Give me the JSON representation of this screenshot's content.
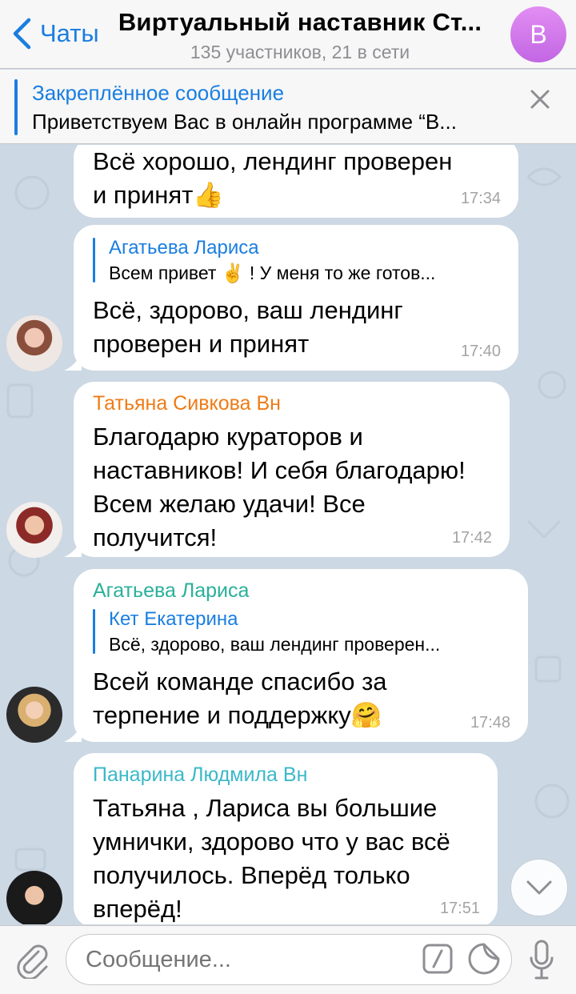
{
  "header": {
    "back_label": "Чаты",
    "title": "Виртуальный наставник Ст...",
    "subtitle": "135 участников, 21 в сети",
    "avatar_letter": "В",
    "avatar_color": "#d580ee"
  },
  "pinned": {
    "title": "Закреплённое сообщение",
    "text": "Приветствуем Вас в онлайн программе “В..."
  },
  "messages": [
    {
      "text": "Всё хорошо, лендинг проверен\nи принят",
      "emoji": "👍",
      "time": "17:34"
    },
    {
      "reply_name": "Агатьева Лариса",
      "reply_text": "Всем привет ✌️ ! У меня то же готов...",
      "text": "Всё, здорово, ваш лендинг\nпроверен и принят",
      "time": "17:40"
    },
    {
      "sender": "Татьяна Сивкова Вн",
      "sender_color": "#ef7b16",
      "text": "Благодарю кураторов и\nнаставников! И себя благодарю!\nВсем желаю удачи! Все\nполучится!",
      "time": "17:42"
    },
    {
      "sender": "Агатьева Лариса",
      "sender_color": "#2ab09a",
      "reply_name": "Кет Екатерина",
      "reply_text": "Всё, здорово, ваш лендинг проверен...",
      "text": "Всей команде спасибо за\nтерпение и поддержку",
      "emoji": "🤗",
      "time": "17:48"
    },
    {
      "sender": "Панарина Людмила Вн",
      "sender_color": "#3bb8c9",
      "text": "Татьяна , Лариса вы большие\nумнички, здорово что у вас всё\nполучилось. Вперёд только\nвперёд!",
      "time": "17:51"
    }
  ],
  "composer": {
    "placeholder": "Сообщение..."
  },
  "icons": {
    "back": "chevron-left-icon",
    "close": "close-icon",
    "attach": "paperclip-icon",
    "command": "slash-command-icon",
    "sticker": "sticker-icon",
    "mic": "microphone-icon",
    "scroll": "chevron-down-icon"
  },
  "colors": {
    "accent": "#1a7ee0",
    "wallpaper": "#ccd8e3"
  }
}
